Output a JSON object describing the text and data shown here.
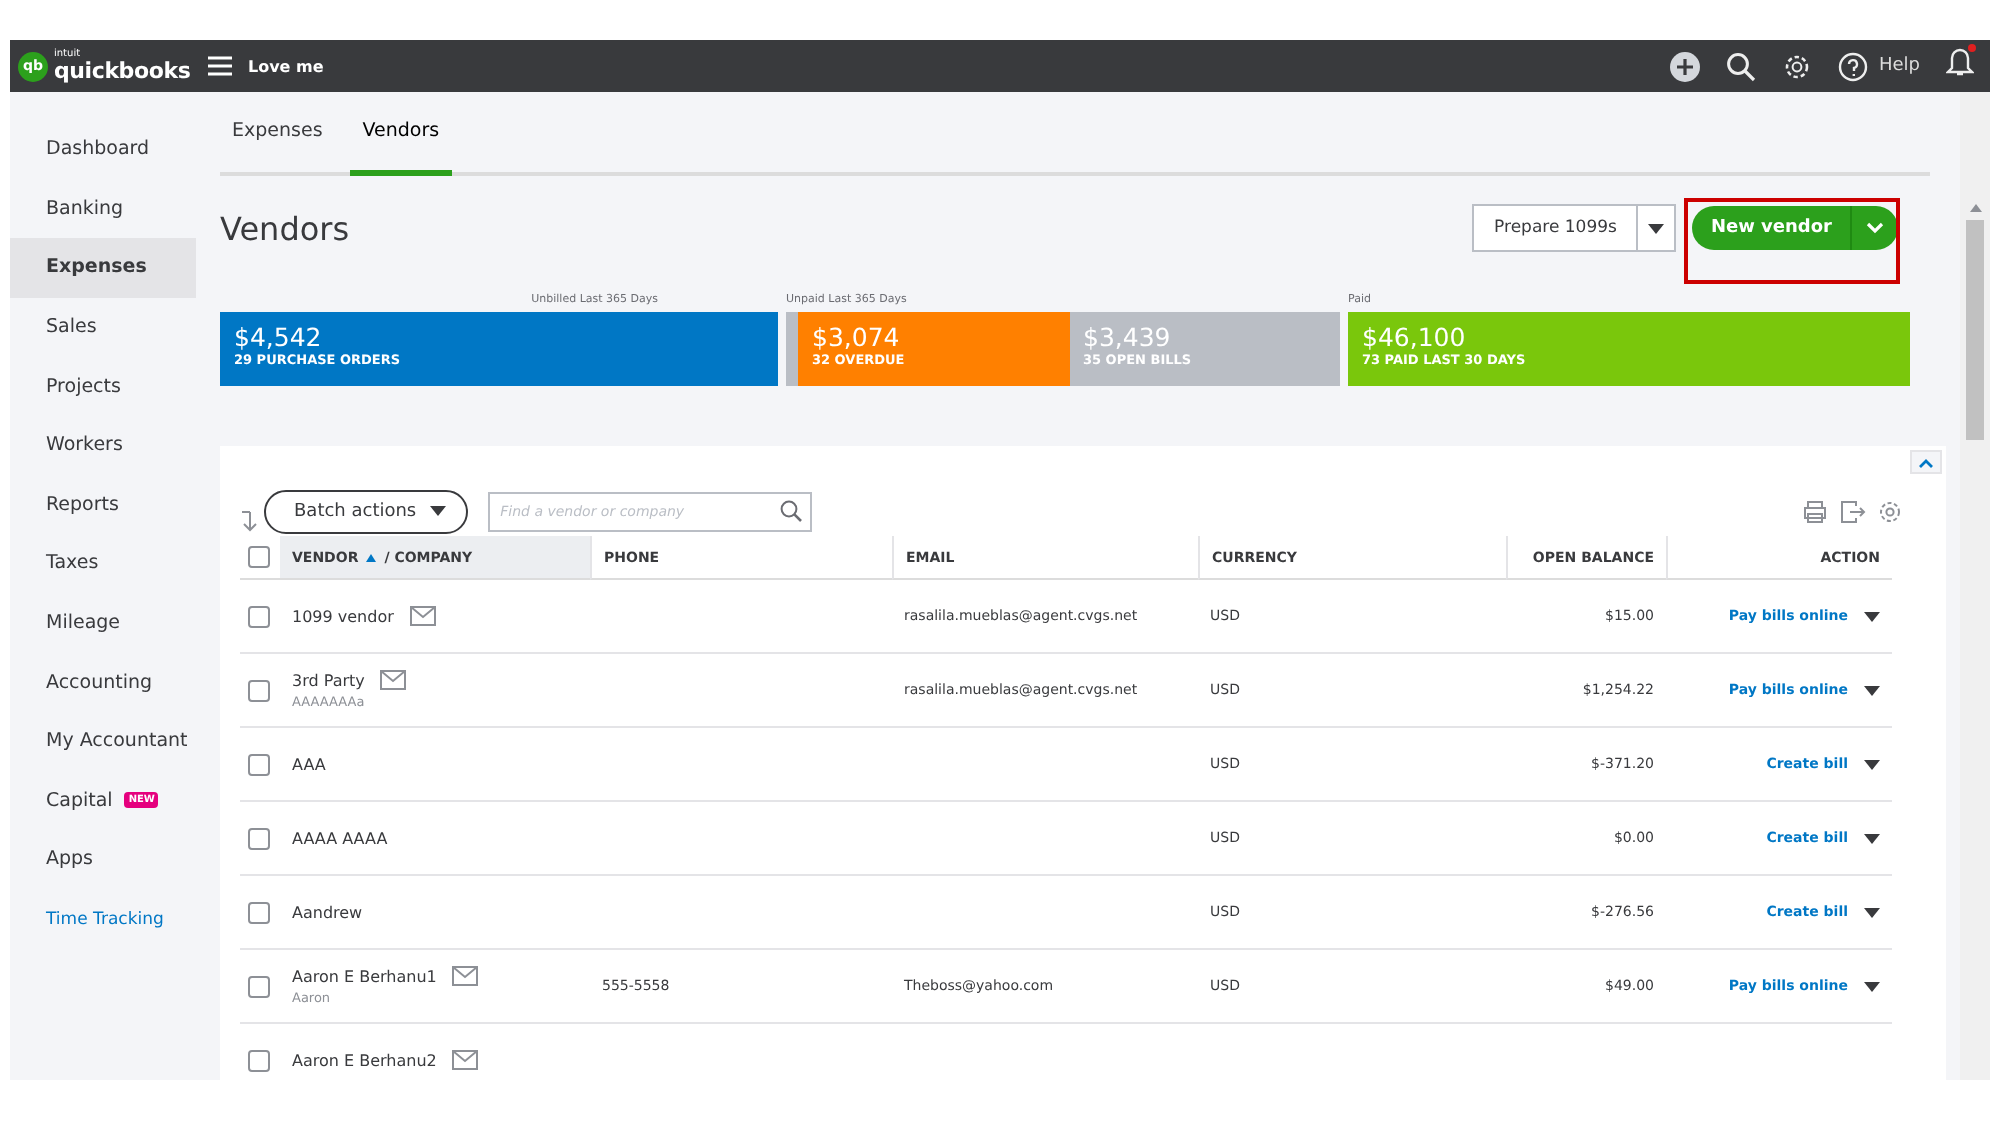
{
  "topbar": {
    "logo_mark": "qb",
    "logo_small": "intuit",
    "logo": "quickbooks",
    "company": "Love me",
    "help": "Help",
    "notification": true
  },
  "sidebar": {
    "items": [
      {
        "label": "Dashboard",
        "selected": false,
        "kind": "nav"
      },
      {
        "label": "Banking",
        "selected": false,
        "kind": "nav"
      },
      {
        "label": "Expenses",
        "selected": true,
        "kind": "nav"
      },
      {
        "label": "Sales",
        "selected": false,
        "kind": "nav"
      },
      {
        "label": "Projects",
        "selected": false,
        "kind": "nav"
      },
      {
        "label": "Workers",
        "selected": false,
        "kind": "nav"
      },
      {
        "label": "Reports",
        "selected": false,
        "kind": "nav"
      },
      {
        "label": "Taxes",
        "selected": false,
        "kind": "nav"
      },
      {
        "label": "Mileage",
        "selected": false,
        "kind": "nav"
      },
      {
        "label": "Accounting",
        "selected": false,
        "kind": "nav"
      },
      {
        "label": "My Accountant",
        "selected": false,
        "kind": "nav"
      },
      {
        "label": "Capital",
        "selected": false,
        "kind": "nav",
        "badge": "NEW"
      },
      {
        "label": "Apps",
        "selected": false,
        "kind": "nav"
      },
      {
        "label": "Time Tracking",
        "selected": false,
        "kind": "link"
      }
    ]
  },
  "tabs": [
    {
      "label": "Expenses",
      "selected": false
    },
    {
      "label": "Vendors",
      "selected": true
    }
  ],
  "page_title": "Vendors",
  "prepare_button": "Prepare 1099s",
  "new_vendor_button": {
    "label": "New vendor",
    "highlighted": true
  },
  "money_bar": [
    {
      "label": "Unbilled Last 365 Days",
      "segments": [
        {
          "amount": "$4,542",
          "caption": "29 PURCHASE ORDERS",
          "color": "#0077c5"
        }
      ]
    },
    {
      "label": "Unpaid Last 365 Days",
      "segments": [
        {
          "amount": "$3,074",
          "caption": "32 OVERDUE",
          "color": "#ff8000"
        },
        {
          "amount": "$3,439",
          "caption": "35 OPEN BILLS",
          "color": "#babec5"
        }
      ]
    },
    {
      "label": "Paid",
      "segments": [
        {
          "amount": "$46,100",
          "caption": "73 PAID LAST 30 DAYS",
          "color": "#7ac70c"
        }
      ]
    }
  ],
  "table": {
    "batch_actions": "Batch actions",
    "search": {
      "placeholder": "Find a vendor or company"
    },
    "select_all": false,
    "columns": [
      {
        "label": "VENDOR",
        "sublabel": "/ COMPANY",
        "sorted": true
      },
      {
        "label": "PHONE",
        "sorted": false
      },
      {
        "label": "EMAIL",
        "sorted": false
      },
      {
        "label": "CURRENCY",
        "sorted": false
      },
      {
        "label": "OPEN BALANCE",
        "sorted": false
      },
      {
        "label": "ACTION",
        "sorted": false
      }
    ],
    "rows": [
      {
        "selected": false,
        "name": "1099 vendor",
        "mail": true,
        "email": "rasalila.mueblas@agent.cvgs.net",
        "currency": "USD",
        "balance": "$15.00",
        "action": "Pay bills online"
      },
      {
        "selected": false,
        "name": "3rd Party",
        "company": "AAAAAAAa",
        "mail": true,
        "email": "rasalila.mueblas@agent.cvgs.net",
        "currency": "USD",
        "balance": "$1,254.22",
        "action": "Pay bills online"
      },
      {
        "selected": false,
        "name": "AAA",
        "mail": false,
        "currency": "USD",
        "balance": "$-371.20",
        "action": "Create bill"
      },
      {
        "selected": false,
        "name": "AAAA AAAA",
        "mail": false,
        "currency": "USD",
        "balance": "$0.00",
        "action": "Create bill"
      },
      {
        "selected": false,
        "name": "Aandrew",
        "mail": false,
        "currency": "USD",
        "balance": "$-276.56",
        "action": "Create bill"
      },
      {
        "selected": false,
        "name": "Aaron E Berhanu1",
        "company": "Aaron",
        "mail": true,
        "phone": "555-5558",
        "email": "Theboss@yahoo.com",
        "currency": "USD",
        "balance": "$49.00",
        "action": "Pay bills online"
      },
      {
        "selected": false,
        "name": "Aaron E Berhanu2",
        "mail": true
      }
    ]
  }
}
